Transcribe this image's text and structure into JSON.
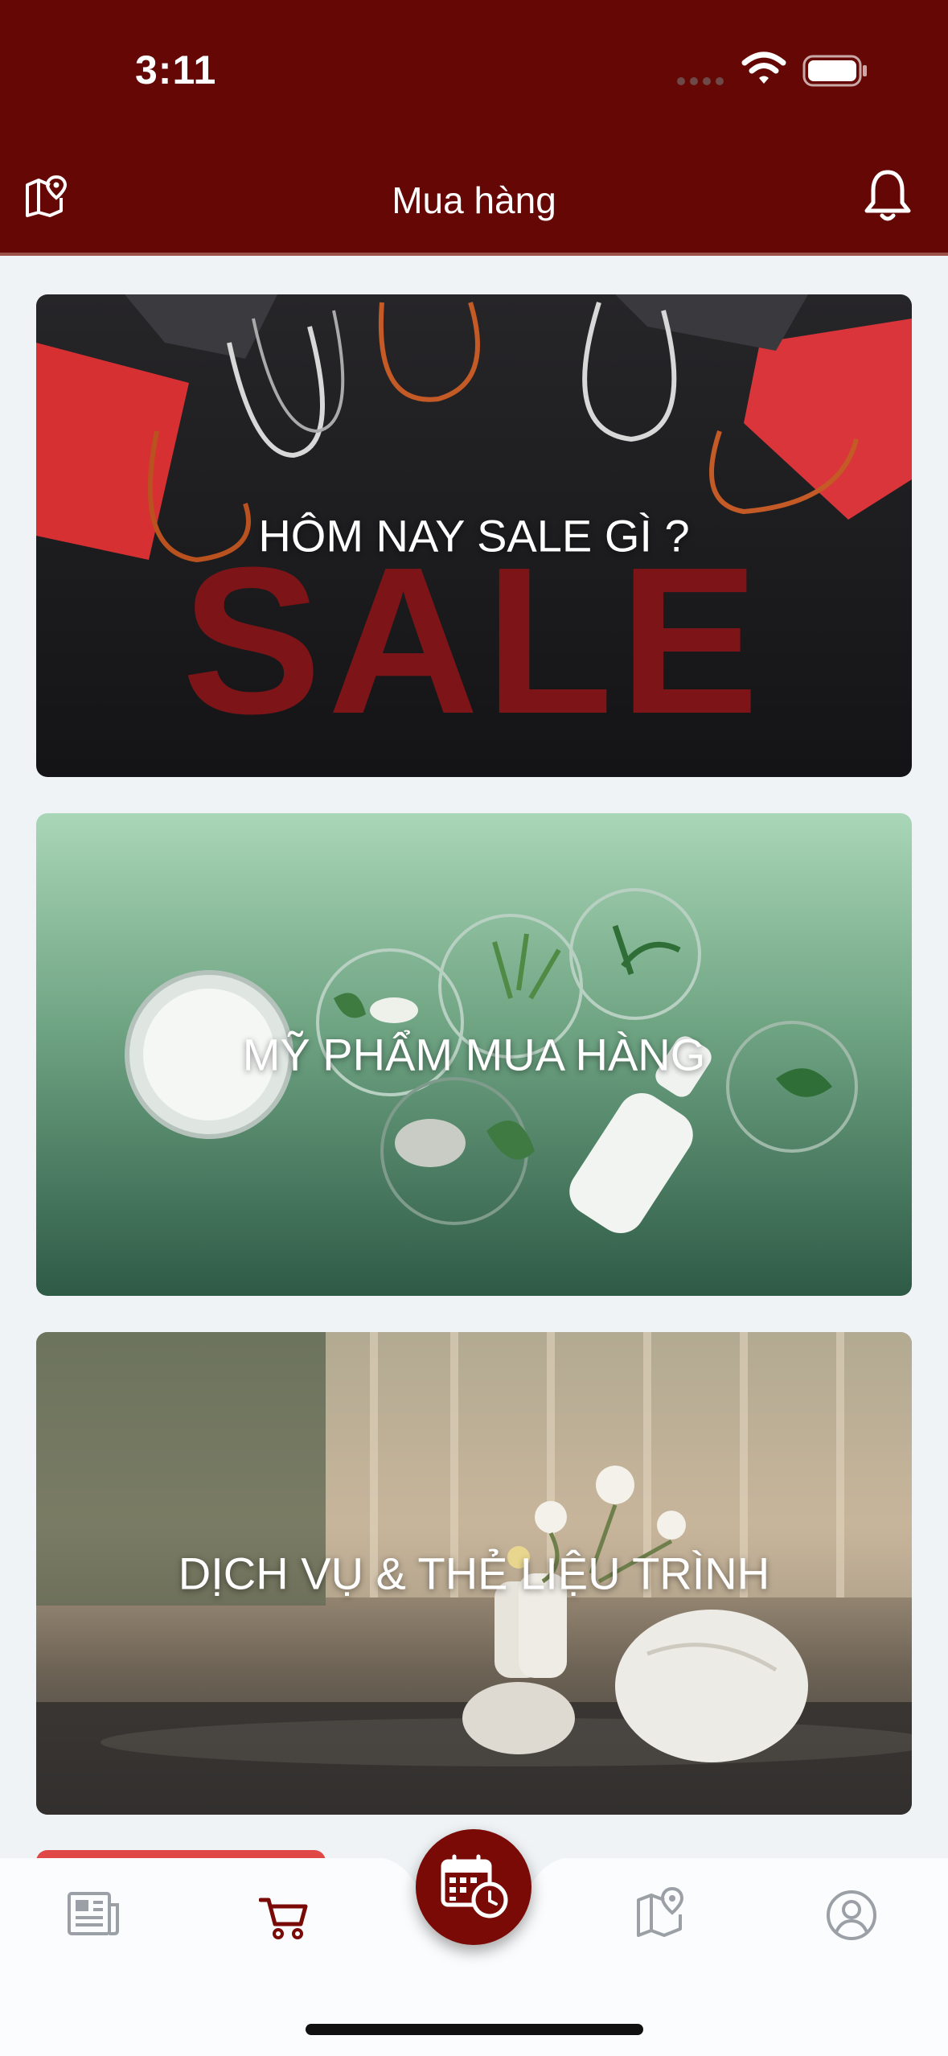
{
  "status_bar": {
    "time": "3:11"
  },
  "header": {
    "title": "Mua hàng",
    "left_icon": "map-pin-icon",
    "right_icon": "bell-icon"
  },
  "cards": [
    {
      "label": "HÔM NAY SALE GÌ ?",
      "image": "sale-bags-image"
    },
    {
      "label": "MỸ PHẨM MUA HÀNG",
      "image": "cosmetics-image"
    },
    {
      "label": "DỊCH VỤ & THẺ LIỆU TRÌNH",
      "image": "spa-image"
    }
  ],
  "tabbar": {
    "items": [
      {
        "icon": "newspaper-icon",
        "active": false
      },
      {
        "icon": "cart-icon",
        "active": true
      },
      {
        "icon": "calendar-clock-icon",
        "center": true
      },
      {
        "icon": "map-pin-icon",
        "active": false
      },
      {
        "icon": "user-icon",
        "active": false
      }
    ]
  },
  "colors": {
    "brand": "#650704",
    "background": "#eff3f6",
    "inactive_icon": "#9aa0a6"
  }
}
